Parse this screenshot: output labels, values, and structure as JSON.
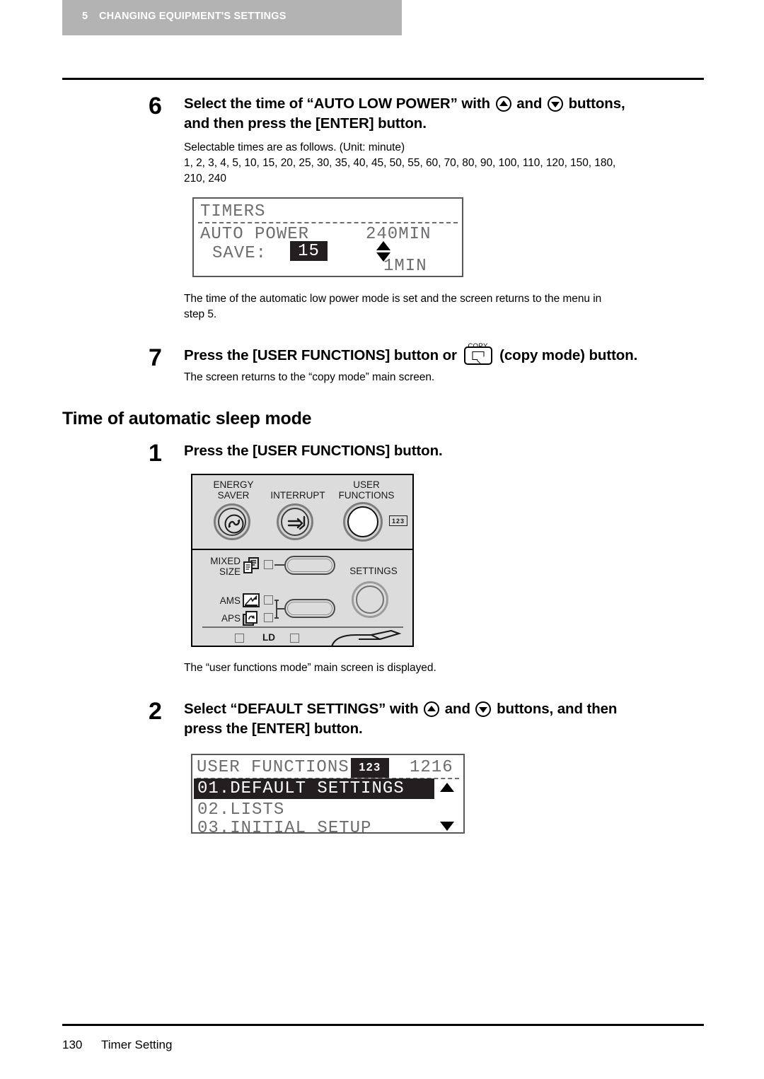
{
  "header": {
    "chapter_number": "5",
    "chapter_title": "CHANGING EQUIPMENT'S SETTINGS"
  },
  "step6": {
    "number": "6",
    "heading_part1": "Select the time of “AUTO LOW POWER” with",
    "heading_and": "and",
    "heading_part2": "buttons,",
    "heading_line2": "and then press the [ENTER] button.",
    "note_line1": "Selectable times are as follows. (Unit: minute)",
    "note_line2": "1, 2, 3, 4, 5, 10, 15, 20, 25, 30, 35, 40, 45, 50, 55, 60, 70, 80, 90, 100, 110, 120, 150, 180,",
    "note_line3": "210, 240",
    "after_line1": "The time of the automatic low power mode is set and the screen returns to the menu in",
    "after_line2": "step 5."
  },
  "lcd_timers": {
    "title": "TIMERS",
    "label_line1": "AUTO POWER",
    "label_line2": "SAVE:",
    "selected_value": "15",
    "max_value": "240MIN",
    "min_value": "1MIN",
    "arrow_up": "up-triangle",
    "arrow_down": "down-triangle"
  },
  "step7": {
    "number": "7",
    "heading_part1": "Press the [USER FUNCTIONS] button or",
    "copy_key_caption": "COPY",
    "heading_part2": "(copy mode) button.",
    "note": "The screen returns to the “copy mode” main screen."
  },
  "section": {
    "title": "Time of automatic sleep mode"
  },
  "step1": {
    "number": "1",
    "heading": "Press the [USER FUNCTIONS] button.",
    "note": "The “user functions mode” main screen is displayed."
  },
  "control_panel": {
    "energy_saver_line1": "ENERGY",
    "energy_saver_line2": "SAVER",
    "interrupt": "INTERRUPT",
    "user_functions_line1": "USER",
    "user_functions_line2": "FUNCTIONS",
    "user_functions_badge": "123",
    "mixed_size_line1": "MIXED",
    "mixed_size_line2": "SIZE",
    "ams": "AMS",
    "aps": "APS",
    "settings": "SETTINGS",
    "paper_size": "LD"
  },
  "step2": {
    "number": "2",
    "heading_part1": "Select “DEFAULT SETTINGS” with",
    "heading_and": "and",
    "heading_part2": "buttons, and then",
    "heading_line2": "press the [ENTER] button."
  },
  "lcd_userfunctions": {
    "title": "USER FUNCTIONS",
    "badge": "123",
    "counter": "1216",
    "items": [
      {
        "label": "01.DEFAULT SETTINGS",
        "selected": true
      },
      {
        "label": "02.LISTS",
        "selected": false
      },
      {
        "label": "03.INITIAL SETUP",
        "selected": false
      }
    ],
    "scroll_up": "up-triangle",
    "scroll_down": "down-triangle"
  },
  "footer": {
    "page_number": "130",
    "section_name": "Timer Setting"
  },
  "colors": {
    "band": "#b3b3b3",
    "panel_bg": "#dcdcdc",
    "lcd_border": "#58585a",
    "highlight": "#231f20"
  }
}
